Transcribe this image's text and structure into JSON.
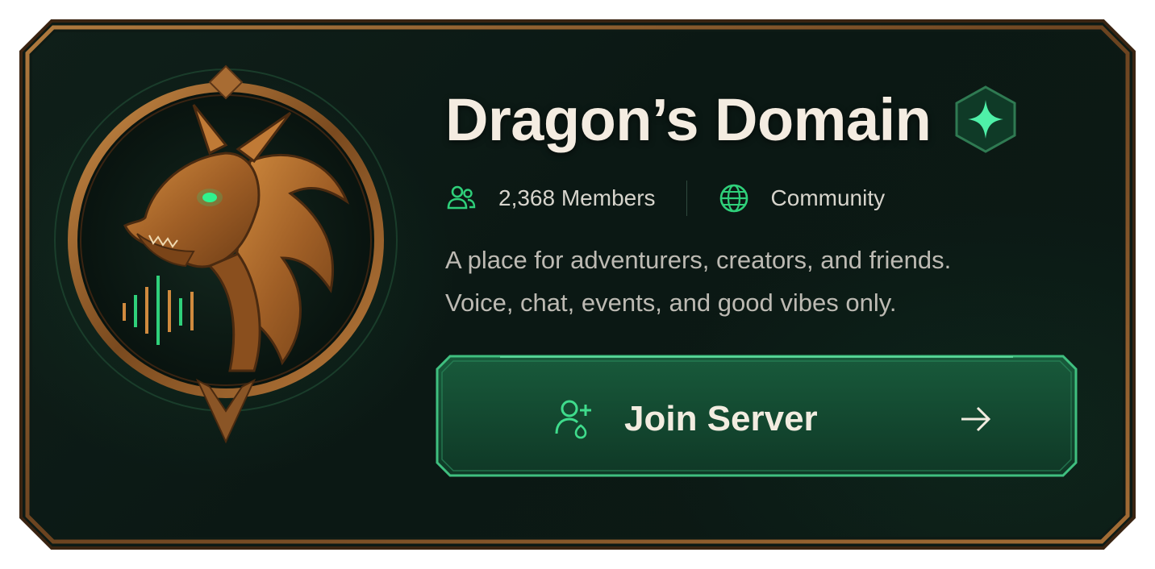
{
  "server": {
    "name": "Dragon’s Domain",
    "verified_icon": "sparkle-badge-icon",
    "members_label": "2,368 Members",
    "category_label": "Community",
    "description_line1": "A place for adventurers, creators, and friends.",
    "description_line2": "Voice, chat, events, and good vibes only."
  },
  "icons": {
    "members": "members-icon",
    "category": "globe-icon",
    "join": "add-user-icon",
    "arrow": "arrow-right-icon",
    "emblem": "dragon-emblem"
  },
  "join_button": {
    "label": "Join Server"
  },
  "colors": {
    "background": "#0c1a15",
    "frame_bronze": "#8a5a2b",
    "accent_green": "#2fd07a",
    "button_fill": "#13452f",
    "title_text": "#f4ece1"
  }
}
